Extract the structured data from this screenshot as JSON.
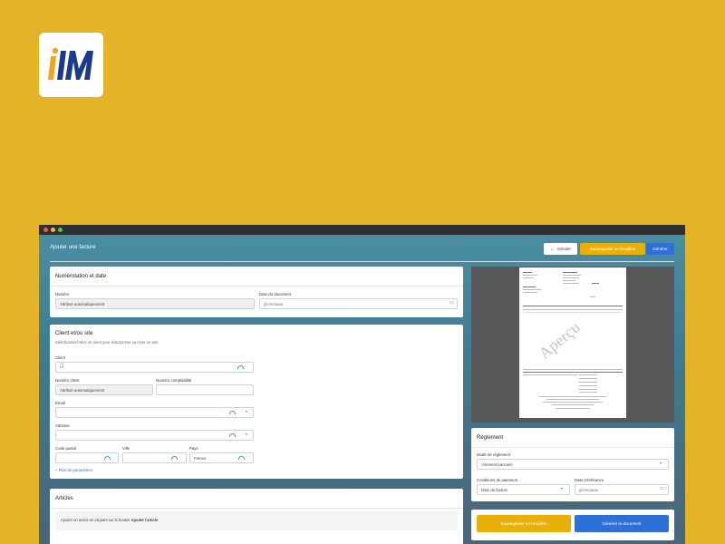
{
  "logo": {
    "text": "IIM"
  },
  "header": {
    "title": "Ajouter une facture",
    "cancel_label": "Annuler",
    "save_draft_label": "Sauvegarder en brouillon",
    "generate_label": "Générer"
  },
  "numerotation": {
    "title": "Numérotation et date",
    "numero_label": "Numéro",
    "numero_value": "Attribué automatiquement",
    "date_label": "Date du document",
    "date_placeholder": "jj/mm/aaaa"
  },
  "client": {
    "title": "Client et/ou site",
    "hint": "Sélectionnez/créez un client pour sélectionner ou créer un site.",
    "client_label": "Client",
    "num_client_label": "Numéro client",
    "num_client_value": "Attribué automatiquement",
    "num_compta_label": "Numéro comptabilité",
    "email_label": "Email",
    "adresse_label": "Adresse",
    "cp_label": "Code postal",
    "ville_label": "Ville",
    "pays_label": "Pays",
    "pays_value": "France",
    "more_params": "Plus de paramètres"
  },
  "articles": {
    "title": "Articles",
    "empty_text": "Ajouter un article en cliquant sur le bouton",
    "empty_link": "Ajouter l'article"
  },
  "preview": {
    "watermark": "Aperçu"
  },
  "reglement": {
    "title": "Règlement",
    "mode_label": "Mode de règlement",
    "mode_value": "Virement bancaire",
    "conditions_label": "Conditions de paiement",
    "conditions_value": "Date de facture",
    "echeance_label": "Date d'échéance",
    "echeance_placeholder": "jj/mm/aaaa"
  },
  "footer": {
    "save_draft_label": "Sauvegarder en brouillon",
    "generate_label": "Générer le document"
  },
  "colors": {
    "background": "#e3b427",
    "primary": "#2f6fd8",
    "warning": "#e8b008"
  }
}
